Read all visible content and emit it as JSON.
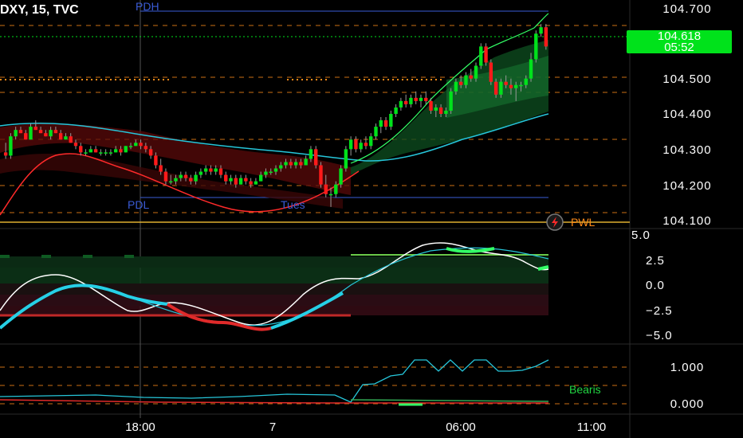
{
  "symbol_title": "DXY, 15, TVC",
  "price_axis": {
    "ticks": [
      "104.700",
      "104.500",
      "104.400",
      "104.300",
      "104.200",
      "104.100"
    ],
    "tick_values": [
      104.7,
      104.5,
      104.4,
      104.3,
      104.2,
      104.1
    ]
  },
  "current_price": {
    "value": "104.618",
    "countdown": "05:52",
    "color": "#00e21b"
  },
  "level_labels": {
    "pdh": "PDH",
    "pdl": "PDL",
    "tues": "Tues",
    "pwl": "PWL"
  },
  "oscillator_axis": {
    "ticks": [
      "5.0",
      "2.5",
      "0.0",
      "−2.5",
      "−5.0"
    ]
  },
  "indicator3_axis": {
    "ticks": [
      "1.000",
      "0.000"
    ],
    "label": "Bearis"
  },
  "time_axis": {
    "ticks": [
      "18:00",
      "7",
      "06:00",
      "11:00"
    ]
  },
  "colors": {
    "bull": "#00e21b",
    "bear": "#ff1a1a",
    "level_blue": "#3a5bd6",
    "level_orange": "#ff8c1a",
    "cyan": "#26c6da"
  },
  "chart_data": {
    "type": "candlestick",
    "ylim": [
      104.08,
      104.74
    ],
    "candles": [
      [
        104.29,
        104.32,
        104.27,
        104.28
      ],
      [
        104.28,
        104.35,
        104.27,
        104.34
      ],
      [
        104.34,
        104.37,
        104.33,
        104.36
      ],
      [
        104.36,
        104.37,
        104.35,
        104.35
      ],
      [
        104.35,
        104.36,
        104.33,
        104.33
      ],
      [
        104.33,
        104.38,
        104.33,
        104.37
      ],
      [
        104.37,
        104.39,
        104.36,
        104.36
      ],
      [
        104.36,
        104.37,
        104.35,
        104.35
      ],
      [
        104.35,
        104.36,
        104.34,
        104.34
      ],
      [
        104.34,
        104.37,
        104.33,
        104.36
      ],
      [
        104.36,
        104.37,
        104.35,
        104.35
      ],
      [
        104.35,
        104.36,
        104.33,
        104.33
      ],
      [
        104.33,
        104.35,
        104.33,
        104.34
      ],
      [
        104.34,
        104.35,
        104.32,
        104.32
      ],
      [
        104.32,
        104.33,
        104.3,
        104.31
      ],
      [
        104.31,
        104.32,
        104.28,
        104.29
      ],
      [
        104.29,
        104.3,
        104.28,
        104.29
      ],
      [
        104.29,
        104.31,
        104.29,
        104.3
      ],
      [
        104.3,
        104.31,
        104.29,
        104.29
      ],
      [
        104.29,
        104.3,
        104.28,
        104.29
      ],
      [
        104.29,
        104.3,
        104.28,
        104.29
      ],
      [
        104.29,
        104.3,
        104.28,
        104.29
      ],
      [
        104.29,
        104.31,
        104.29,
        104.3
      ],
      [
        104.3,
        104.31,
        104.28,
        104.29
      ],
      [
        104.29,
        104.31,
        104.29,
        104.31
      ],
      [
        104.31,
        104.32,
        104.3,
        104.31
      ],
      [
        104.31,
        104.33,
        104.31,
        104.32
      ],
      [
        104.32,
        104.33,
        104.3,
        104.31
      ],
      [
        104.31,
        104.32,
        104.29,
        104.3
      ],
      [
        104.3,
        104.31,
        104.27,
        104.28
      ],
      [
        104.28,
        104.29,
        104.24,
        104.25
      ],
      [
        104.25,
        104.27,
        104.22,
        104.23
      ],
      [
        104.23,
        104.24,
        104.19,
        104.2
      ],
      [
        104.2,
        104.22,
        104.19,
        104.2
      ],
      [
        104.2,
        104.22,
        104.19,
        104.21
      ],
      [
        104.21,
        104.23,
        104.2,
        104.22
      ],
      [
        104.22,
        104.23,
        104.2,
        104.21
      ],
      [
        104.21,
        104.22,
        104.19,
        104.2
      ],
      [
        104.2,
        104.23,
        104.19,
        104.22
      ],
      [
        104.22,
        104.24,
        104.21,
        104.23
      ],
      [
        104.23,
        104.25,
        104.22,
        104.24
      ],
      [
        104.24,
        104.25,
        104.22,
        104.23
      ],
      [
        104.23,
        104.25,
        104.22,
        104.24
      ],
      [
        104.24,
        104.25,
        104.21,
        104.22
      ],
      [
        104.22,
        104.23,
        104.19,
        104.2
      ],
      [
        104.2,
        104.22,
        104.19,
        104.21
      ],
      [
        104.21,
        104.22,
        104.18,
        104.19
      ],
      [
        104.19,
        104.22,
        104.19,
        104.21
      ],
      [
        104.21,
        104.22,
        104.19,
        104.2
      ],
      [
        104.2,
        104.21,
        104.18,
        104.19
      ],
      [
        104.19,
        104.21,
        104.19,
        104.2
      ],
      [
        104.2,
        104.23,
        104.2,
        104.22
      ],
      [
        104.22,
        104.24,
        104.21,
        104.23
      ],
      [
        104.23,
        104.24,
        104.22,
        104.23
      ],
      [
        104.23,
        104.25,
        104.22,
        104.24
      ],
      [
        104.24,
        104.26,
        104.23,
        104.25
      ],
      [
        104.25,
        104.27,
        104.24,
        104.26
      ],
      [
        104.26,
        104.27,
        104.24,
        104.25
      ],
      [
        104.25,
        104.27,
        104.24,
        104.26
      ],
      [
        104.26,
        104.27,
        104.24,
        104.25
      ],
      [
        104.25,
        104.28,
        104.25,
        104.27
      ],
      [
        104.27,
        104.31,
        104.26,
        104.3
      ],
      [
        104.3,
        104.31,
        104.24,
        104.25
      ],
      [
        104.25,
        104.26,
        104.18,
        104.19
      ],
      [
        104.19,
        104.22,
        104.15,
        104.16
      ],
      [
        104.16,
        104.18,
        104.12,
        104.16
      ],
      [
        104.16,
        104.2,
        104.15,
        104.19
      ],
      [
        104.19,
        104.25,
        104.18,
        104.24
      ],
      [
        104.24,
        104.31,
        104.23,
        104.3
      ],
      [
        104.3,
        104.34,
        104.28,
        104.33
      ],
      [
        104.33,
        104.34,
        104.29,
        104.3
      ],
      [
        104.3,
        104.33,
        104.29,
        104.32
      ],
      [
        104.32,
        104.34,
        104.3,
        104.31
      ],
      [
        104.31,
        104.35,
        104.3,
        104.34
      ],
      [
        104.34,
        104.38,
        104.33,
        104.37
      ],
      [
        104.37,
        104.4,
        104.35,
        104.39
      ],
      [
        104.39,
        104.4,
        104.36,
        104.37
      ],
      [
        104.37,
        104.42,
        104.36,
        104.41
      ],
      [
        104.41,
        104.44,
        104.4,
        104.43
      ],
      [
        104.43,
        104.46,
        104.42,
        104.45
      ],
      [
        104.45,
        104.47,
        104.43,
        104.44
      ],
      [
        104.44,
        104.47,
        104.43,
        104.46
      ],
      [
        104.46,
        104.48,
        104.44,
        104.45
      ],
      [
        104.45,
        104.47,
        104.43,
        104.46
      ],
      [
        104.46,
        104.48,
        104.44,
        104.45
      ],
      [
        104.45,
        104.46,
        104.41,
        104.42
      ],
      [
        104.42,
        104.44,
        104.4,
        104.43
      ],
      [
        104.43,
        104.44,
        104.4,
        104.41
      ],
      [
        104.41,
        104.43,
        104.4,
        104.42
      ],
      [
        104.42,
        104.49,
        104.41,
        104.48
      ],
      [
        104.48,
        104.52,
        104.47,
        104.51
      ],
      [
        104.51,
        104.53,
        104.49,
        104.5
      ],
      [
        104.5,
        104.54,
        104.49,
        104.53
      ],
      [
        104.53,
        104.55,
        104.51,
        104.52
      ],
      [
        104.52,
        104.57,
        104.51,
        104.56
      ],
      [
        104.56,
        104.63,
        104.55,
        104.62
      ],
      [
        104.62,
        104.63,
        104.56,
        104.57
      ],
      [
        104.57,
        104.58,
        104.5,
        104.51
      ],
      [
        104.51,
        104.52,
        104.46,
        104.47
      ],
      [
        104.47,
        104.52,
        104.46,
        104.51
      ],
      [
        104.51,
        104.53,
        104.49,
        104.5
      ],
      [
        104.5,
        104.52,
        104.47,
        104.49
      ],
      [
        104.49,
        104.51,
        104.45,
        104.5
      ],
      [
        104.5,
        104.51,
        104.48,
        104.5
      ],
      [
        104.5,
        104.53,
        104.49,
        104.52
      ],
      [
        104.52,
        104.6,
        104.51,
        104.58
      ],
      [
        104.58,
        104.67,
        104.57,
        104.66
      ],
      [
        104.66,
        104.69,
        104.65,
        104.68
      ],
      [
        104.68,
        104.69,
        104.61,
        104.62
      ]
    ]
  }
}
